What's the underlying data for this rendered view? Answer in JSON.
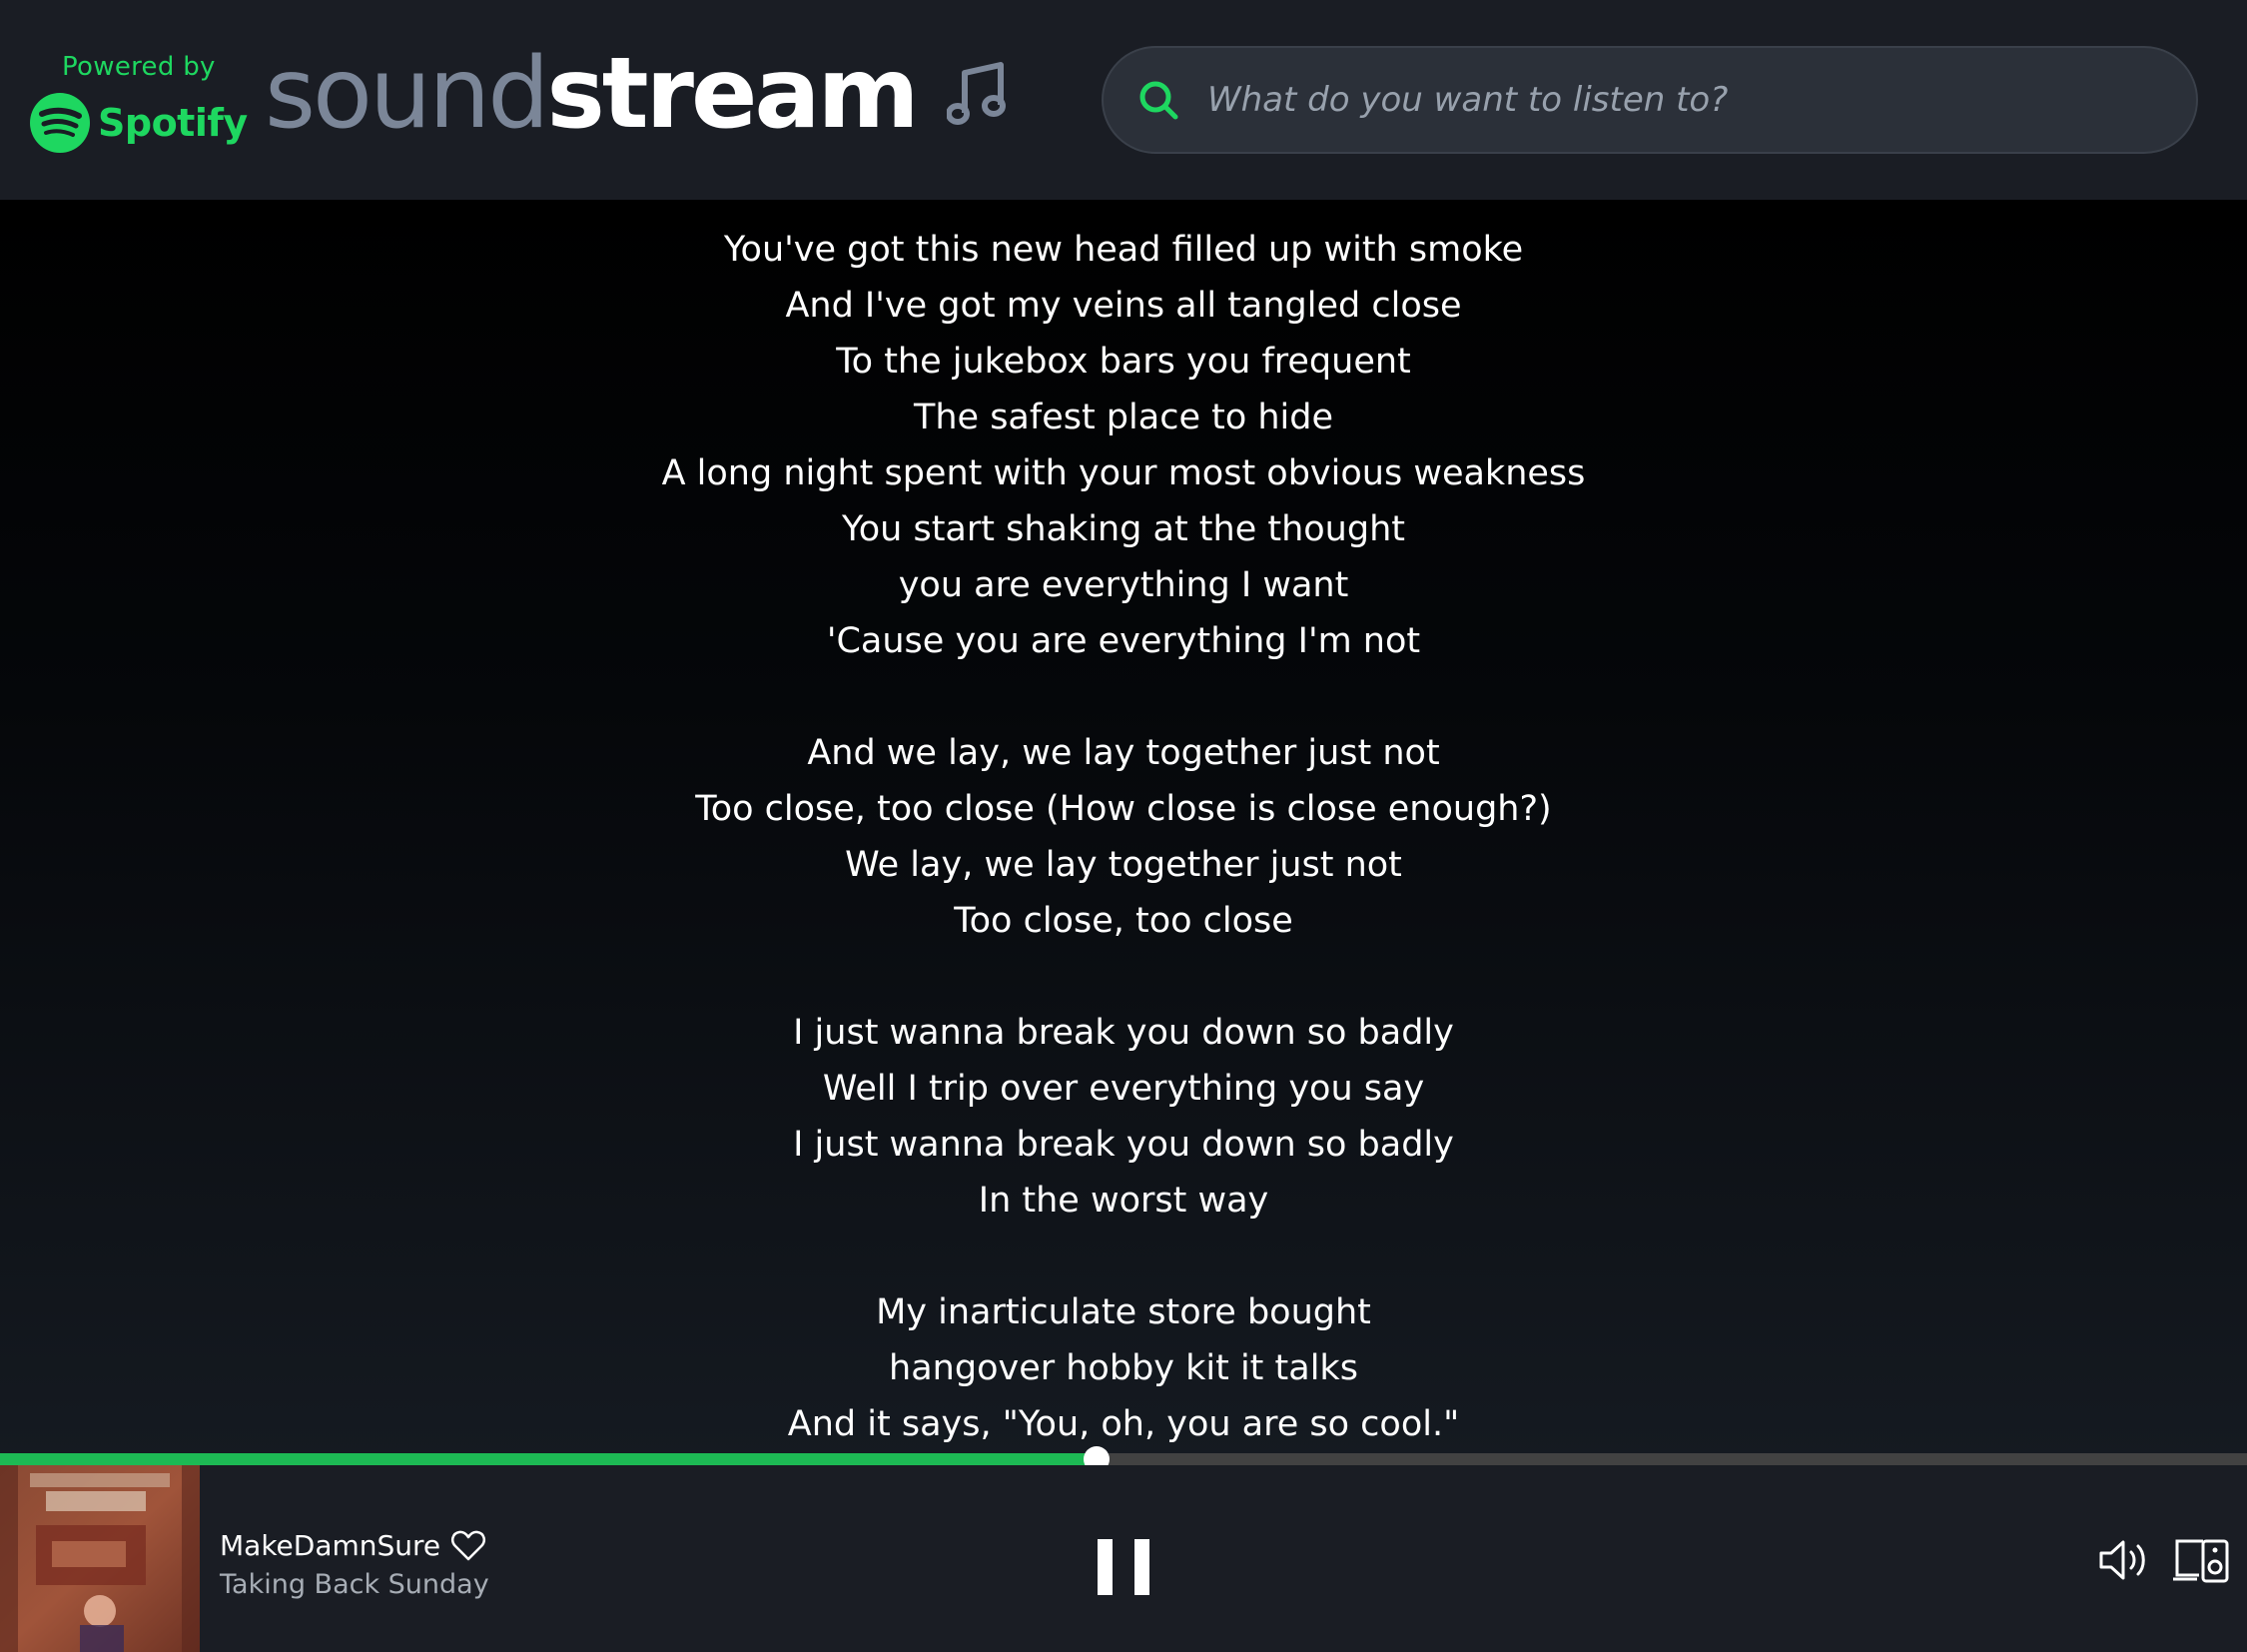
{
  "header": {
    "powered_by": "Powered by",
    "spotify_word": "Spotify",
    "brand_sound": "sound",
    "brand_stream": "stream",
    "icons": {
      "logo": "spotify-logo-icon",
      "note": "music-note-icon",
      "search": "search-icon"
    }
  },
  "search": {
    "placeholder": "What do you want to listen to?",
    "value": ""
  },
  "lyrics": [
    "You've got this new head filled up with smoke",
    "And I've got my veins all tangled close",
    "To the jukebox bars you frequent",
    "The safest place to hide",
    "A long night spent with your most obvious weakness",
    "You start shaking at the thought",
    "you are everything I want",
    "'Cause you are everything I'm not",
    "",
    "And we lay, we lay together just not",
    "Too close, too close (How close is close enough?)",
    "We lay, we lay together just not",
    "Too close, too close",
    "",
    "I just wanna break you down so badly",
    "Well I trip over everything you say",
    "I just wanna break you down so badly",
    "In the worst way",
    "",
    "My inarticulate store bought",
    "hangover hobby kit it talks",
    "And it says, \"You, oh, you are so cool.\""
  ],
  "player": {
    "title": "MakeDamnSure",
    "artist": "Taking Back Sunday",
    "progress_fraction": 0.488,
    "icons": {
      "like": "heart-icon",
      "play_state": "pause-icon",
      "volume": "volume-icon",
      "devices": "devices-icon"
    }
  },
  "colors": {
    "accent": "#1db954",
    "header_bg": "#1a1d24",
    "brand_muted": "#7b8698",
    "search_bg": "#2b3039",
    "progress_track": "#424242"
  }
}
